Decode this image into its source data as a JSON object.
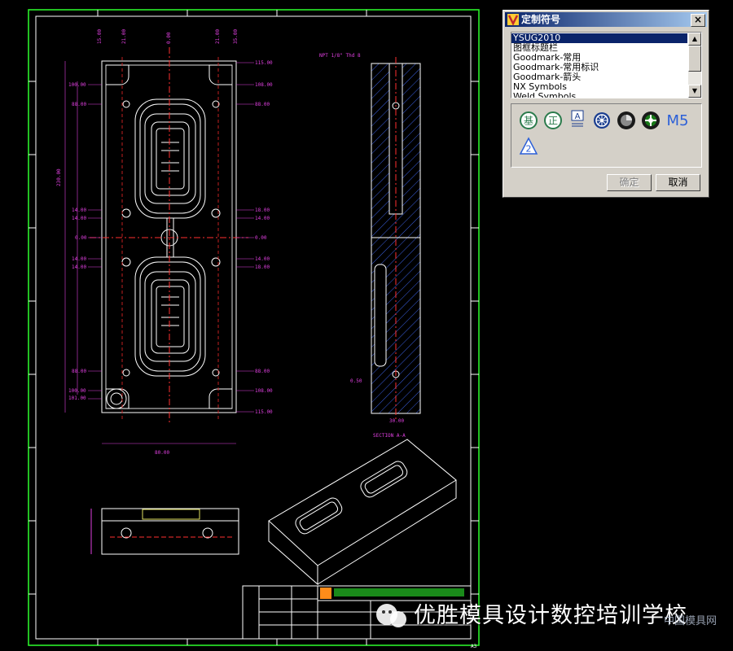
{
  "dialog": {
    "title": "定制符号",
    "close_label": "×",
    "list_items": [
      "YSUG2010",
      "图框标题栏",
      "Goodmark-常用",
      "Goodmark-常用标识",
      "Goodmark-箭头",
      "NX Symbols",
      "Weld Symbols"
    ],
    "selected_index": 0,
    "symbols": [
      {
        "name": "symbol-ji-icon",
        "glyph": "基",
        "color": "#2b7b4c"
      },
      {
        "name": "symbol-zheng-icon",
        "glyph": "正",
        "color": "#2b7b4c"
      },
      {
        "name": "symbol-a-box-icon",
        "glyph": "A",
        "color": "#1a3d8f"
      },
      {
        "name": "symbol-wheel-icon",
        "glyph": "",
        "color": "#1a3d8f"
      },
      {
        "name": "symbol-gear-icon",
        "glyph": "",
        "color": "#1a1a1a"
      },
      {
        "name": "symbol-target-icon",
        "glyph": "",
        "color": "#1a7a1a"
      },
      {
        "name": "symbol-m5-icon",
        "glyph": "M5",
        "color": "#2b5fd8"
      },
      {
        "name": "symbol-triangle-2-icon",
        "glyph": "2",
        "color": "#2b5fd8"
      }
    ],
    "ok_label": "确定",
    "cancel_label": "取消"
  },
  "drawing": {
    "dims_left": [
      "100.00",
      "88.00",
      "14.00",
      "14.00",
      "0.00",
      "14.00",
      "14.00",
      "88.00",
      "100.00",
      "101.00"
    ],
    "dims_right": [
      "115.00",
      "108.00",
      "88.00",
      "18.00",
      "14.00",
      "0.00",
      "14.00",
      "18.00",
      "88.00",
      "108.00",
      "115.00"
    ],
    "dims_top": [
      "15.00",
      "21.00",
      "0.00",
      "21.00",
      "35.00"
    ],
    "dim_total": "230.00",
    "dim_bottom": "80.00",
    "section_label": "SECTION A-A",
    "section_width": "30.00",
    "hole_note": "NPT 1/8\" Thd 8",
    "note_small": "0.50",
    "sheet_label": "A3"
  },
  "watermark": {
    "text": "优胜模具设计数控培训学校",
    "site": "中国模具网"
  }
}
